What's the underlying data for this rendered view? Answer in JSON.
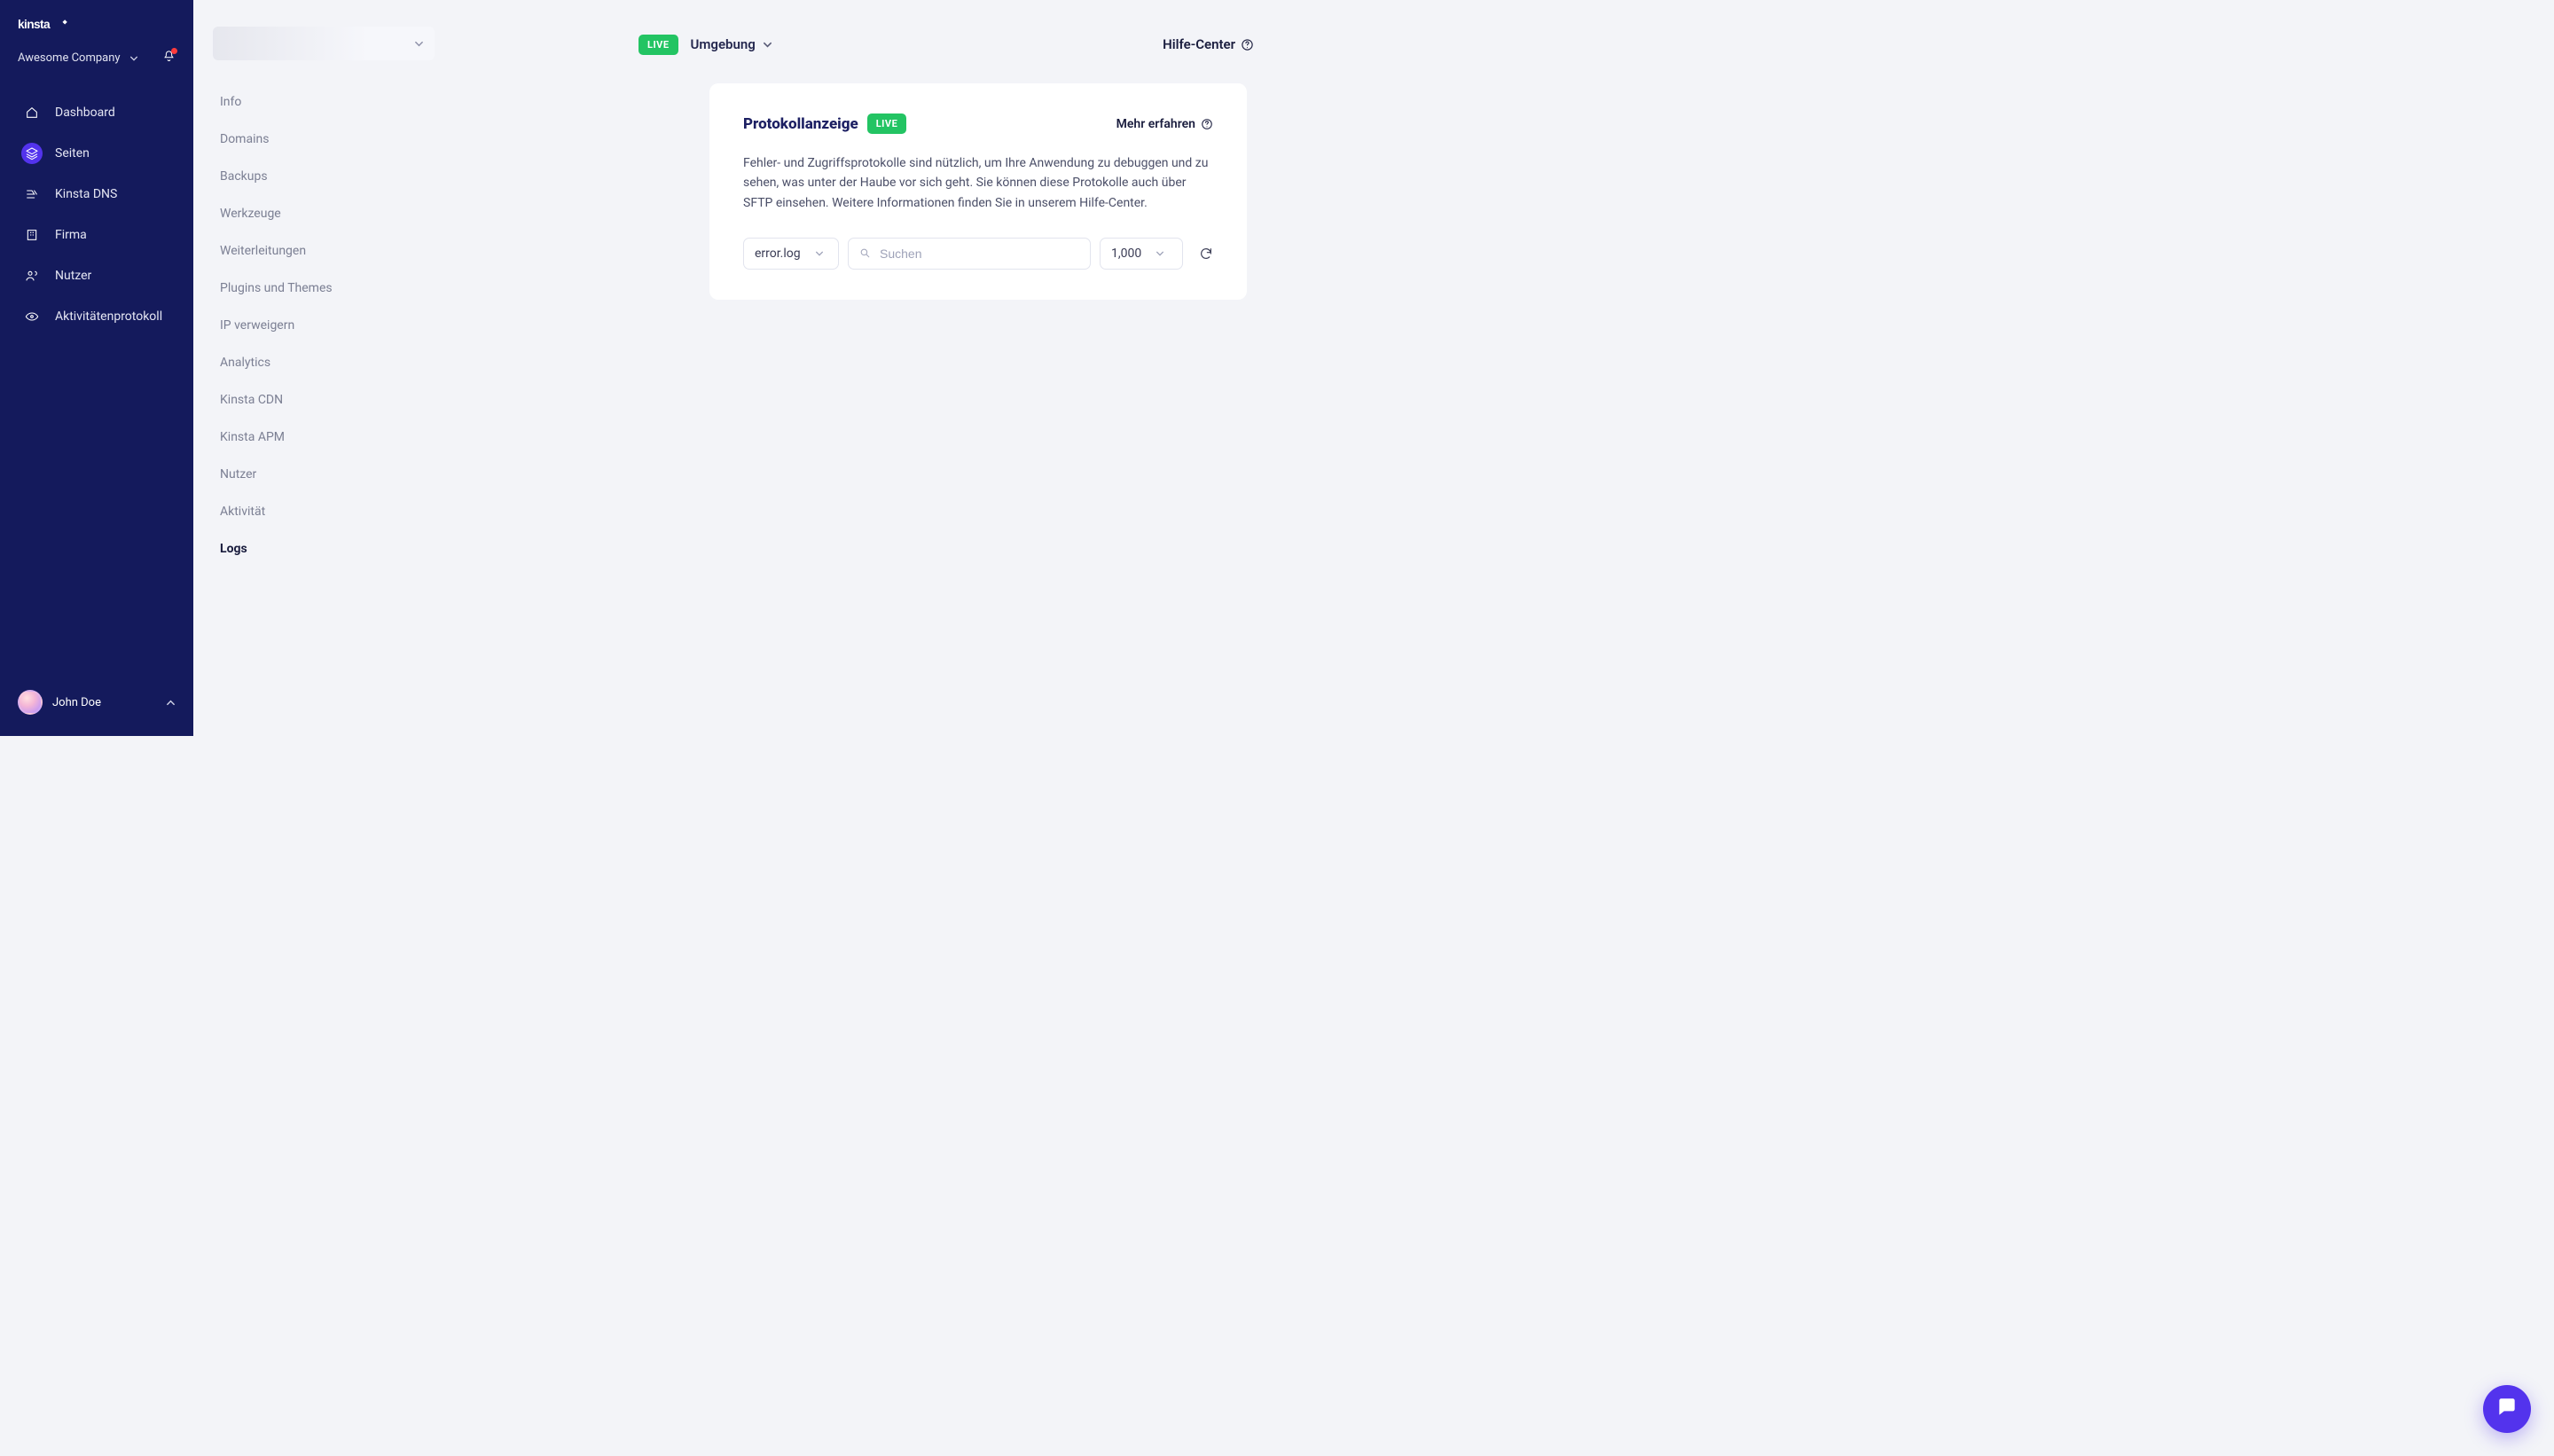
{
  "sidebar": {
    "company": "Awesome Company",
    "nav": [
      {
        "label": "Dashboard",
        "icon": "home-icon"
      },
      {
        "label": "Seiten",
        "icon": "layers-icon"
      },
      {
        "label": "Kinsta DNS",
        "icon": "route-icon"
      },
      {
        "label": "Firma",
        "icon": "building-icon"
      },
      {
        "label": "Nutzer",
        "icon": "users-icon"
      },
      {
        "label": "Aktivitätenprotokoll",
        "icon": "eye-icon"
      }
    ],
    "user": "John Doe"
  },
  "subnav": {
    "items": [
      "Info",
      "Domains",
      "Backups",
      "Werkzeuge",
      "Weiterleitungen",
      "Plugins und Themes",
      "IP verweigern",
      "Analytics",
      "Kinsta CDN",
      "Kinsta APM",
      "Nutzer",
      "Aktivität",
      "Logs"
    ],
    "active_index": 12
  },
  "top": {
    "env_badge": "LIVE",
    "env_label": "Umgebung",
    "help": "Hilfe-Center"
  },
  "card": {
    "title": "Protokollanzeige",
    "badge": "LIVE",
    "learn_more": "Mehr erfahren",
    "description": "Fehler- und Zugriffsprotokolle sind nützlich, um Ihre Anwendung zu debuggen und zu sehen, was unter der Haube vor sich geht. Sie können diese Protokolle auch über SFTP einsehen. Weitere Informationen finden Sie in unserem Hilfe-Center.",
    "log_select": "error.log",
    "search_placeholder": "Suchen",
    "limit_select": "1,000"
  }
}
